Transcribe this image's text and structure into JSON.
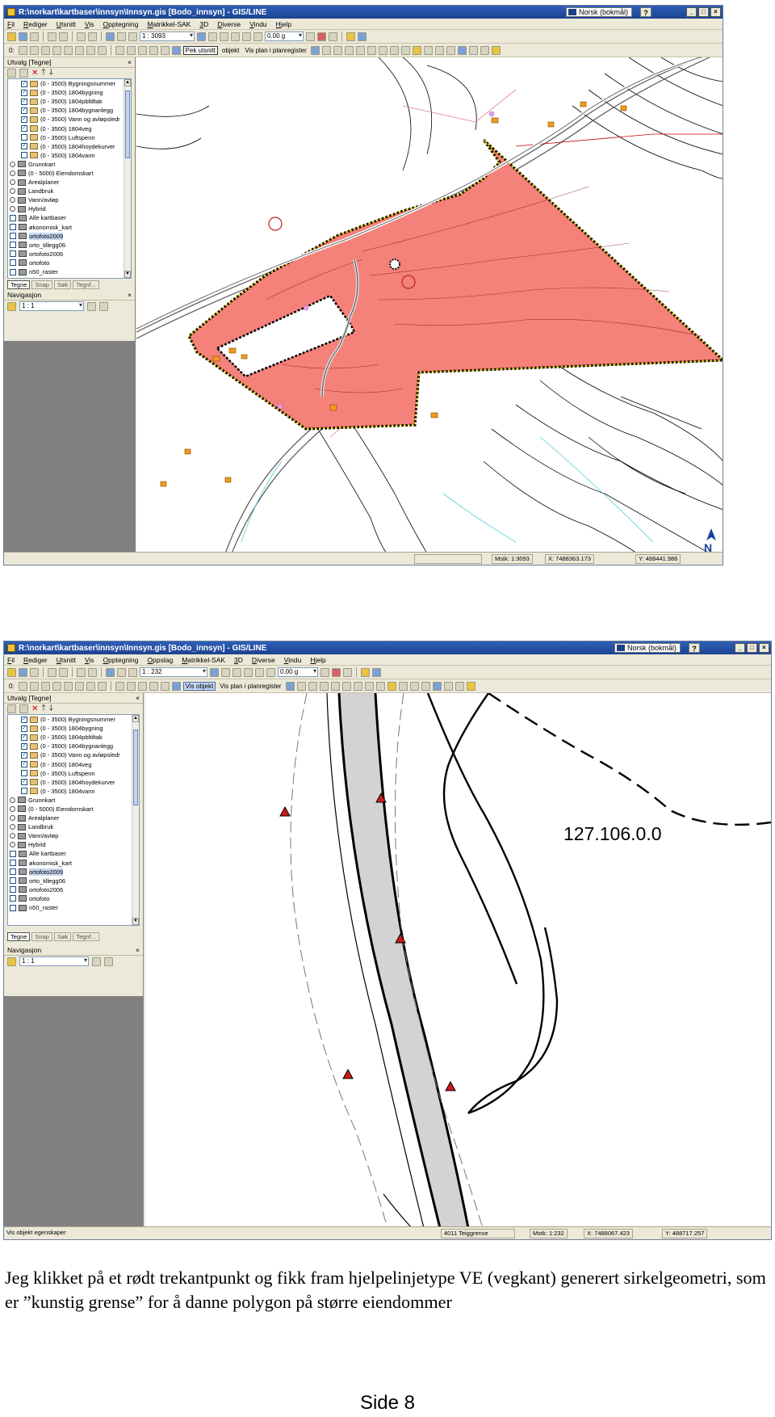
{
  "screenshot_top": {
    "window_title": "R:\\norkart\\kartbaser\\innsyn\\Innsyn.gis [Bodo_innsyn] - GIS/LINE",
    "language": "Norsk (bokmål)",
    "menu": [
      "Fil",
      "Rediger",
      "Utsnitt",
      "Vis",
      "Opptegning",
      "Matrikkel-SAK",
      "3D",
      "Diverse",
      "Vindu",
      "Hjelp"
    ],
    "scale": "1 : 3093",
    "angle": "0.00 g",
    "snap_field": "0:",
    "toolbar_buttons": [
      "Pek utsnitt",
      "objekt",
      "Vis plan i planregister"
    ],
    "panel_title": "Utvalg [Tegne]",
    "layers": [
      {
        "label": "(0 - 3500) Bygningsnummer",
        "checked": true
      },
      {
        "label": "(0 - 3500) 1804bygning",
        "checked": true
      },
      {
        "label": "(0 - 3500) 1804pbltiltak",
        "checked": true
      },
      {
        "label": "(0 - 3500) 1804bygnanlegg",
        "checked": true
      },
      {
        "label": "(0 - 3500) Vann og avløpsledr",
        "checked": true
      },
      {
        "label": "(0 - 3500) 1804veg",
        "checked": true
      },
      {
        "label": "(0 - 3500) Luftspenn",
        "checked": false
      },
      {
        "label": "(0 - 3500) 1804hoydekurver",
        "checked": true
      },
      {
        "label": "(0 - 3500) 1804vann",
        "checked": false
      },
      {
        "label": "Grunnkart",
        "kind": "radio"
      },
      {
        "label": "(0 - 5000) Eiendomskart",
        "kind": "radio"
      },
      {
        "label": "Arealplaner",
        "kind": "radio"
      },
      {
        "label": "Landbruk",
        "kind": "radio"
      },
      {
        "label": "Vann/avløp",
        "kind": "radio"
      },
      {
        "label": "Hybrid",
        "kind": "radio"
      },
      {
        "label": "Alle kartbaser",
        "kind": "check"
      },
      {
        "label": "økonomisk_kart",
        "kind": "check"
      },
      {
        "label": "ortofoto2009",
        "kind": "check",
        "highlight": true
      },
      {
        "label": "orto_tillegg06",
        "kind": "check"
      },
      {
        "label": "ortofoto2006",
        "kind": "check"
      },
      {
        "label": "ortofoto",
        "kind": "check"
      },
      {
        "label": "n50_raster",
        "kind": "check"
      }
    ],
    "tabs": [
      "Tegne",
      "Snap",
      "Søk",
      "Tegnf..."
    ],
    "nav_title": "Navigasjon",
    "nav_scale": "1 : 1",
    "status": {
      "scale": "Mstk: 1:3093",
      "x": "X: 7488363.173",
      "y": "Y: 488441.986"
    }
  },
  "screenshot_bottom": {
    "window_title": "R:\\norkart\\kartbaser\\innsyn\\Innsyn.gis [Bodo_innsyn] - GIS/LINE",
    "language": "Norsk (bokmål)",
    "menu": [
      "Fil",
      "Rediger",
      "Utsnitt",
      "Vis",
      "Opptegning",
      "Oppslag",
      "Matrikkel-SAK",
      "3D",
      "Diverse",
      "Vindu",
      "Hjelp"
    ],
    "scale": "1 : 232",
    "angle": "0.00 g",
    "snap_field": "0:",
    "toolbar_buttons": [
      "Vis objekt",
      "Vis plan i planregister"
    ],
    "panel_title": "Utvalg [Tegne]",
    "map_label": "127.106.0.0",
    "tabs": [
      "Tegne",
      "Snap",
      "Søk",
      "Tegnf..."
    ],
    "nav_title": "Navigasjon",
    "nav_scale": "1 : 1",
    "status": {
      "left": "Vis objekt egenskaper",
      "object": "4011 Teiggrense",
      "scale": "Mstk: 1:232",
      "x": "X: 7488067.423",
      "y": "Y: 488717.257"
    }
  },
  "caption": "Jeg klikket på et rødt trekantpunkt og fikk fram hjelpelinjetype VE (vegkant) generert sirkelgeometri, som er ”kunstig grense” for å danne polygon på større eiendommer",
  "page_number": "Side 8",
  "colors": {
    "polygon_fill": "#f4817a",
    "titlebar": "#2e5fb8",
    "panel_grey": "#808080",
    "road_fill": "#d3d3d3"
  }
}
